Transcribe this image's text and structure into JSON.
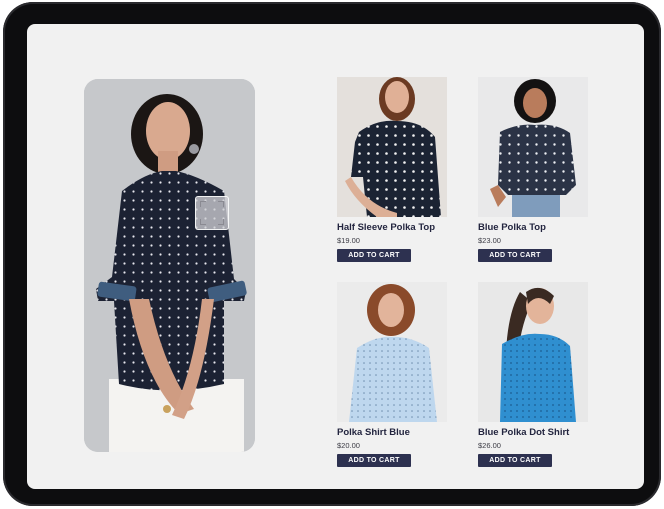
{
  "products": [
    {
      "name": "Half Sleeve Polka Top",
      "price": "$19.00",
      "button": "ADD TO CART"
    },
    {
      "name": "Blue Polka Top",
      "price": "$23.00",
      "button": "ADD TO CART"
    },
    {
      "name": "Polka Shirt Blue",
      "price": "$20.00",
      "button": "ADD TO CART"
    },
    {
      "name": "Blue Polka Dot Shirt",
      "price": "$26.00",
      "button": "ADD TO CART"
    }
  ],
  "colors": {
    "button_bg": "#2d3150",
    "title_text": "#23253f",
    "screen_bg": "#f1f1f1",
    "navy_shirt": "#1c2233",
    "light_blue_shirt": "#bcd6ee",
    "bright_blue_shirt": "#2f8fd0"
  },
  "icons": {
    "scan_box": "visual-search-scan-icon"
  }
}
